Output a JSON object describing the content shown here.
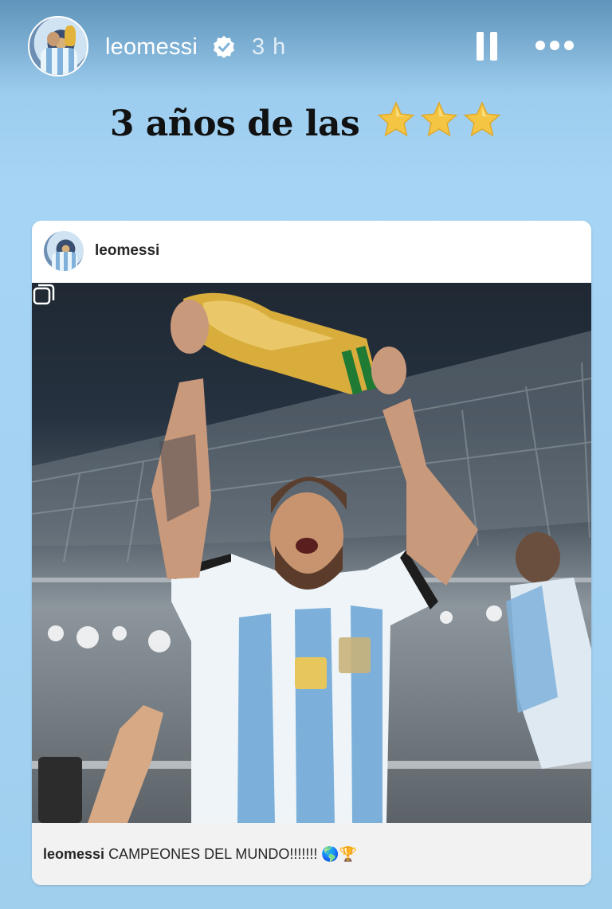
{
  "story": {
    "username": "leomessi",
    "time": "3 h",
    "headline": "3 años de las",
    "headline_stars": 3
  },
  "post": {
    "username": "leomessi",
    "caption_user": "leomessi",
    "caption_text": "CAMPEONES DEL MUNDO!!!!!!! 🌎🏆"
  },
  "icons": {
    "verified": "verified-badge-icon",
    "pause": "pause-icon",
    "more": "more-options-icon",
    "multi": "carousel-icon",
    "star": "star-icon"
  },
  "colors": {
    "background": "#a6d4f4",
    "star": "#f4c542",
    "verified": "#ffffff"
  }
}
